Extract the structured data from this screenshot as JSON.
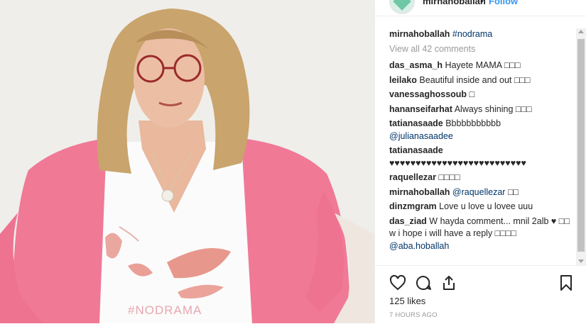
{
  "post": {
    "username": "mirnahoballah",
    "separator": "•",
    "follow_label": "Follow",
    "photo_shirt_text": "#NODRAMA"
  },
  "caption": {
    "username": "mirnahoballah",
    "text": "#nodrama"
  },
  "view_all": "View all 42 comments",
  "comments": [
    {
      "user": "das_asma_h",
      "text": "Hayete MAMA □□□"
    },
    {
      "user": "leilako",
      "text": "Beautiful inside and out □□□"
    },
    {
      "user": "vanessaghossoub",
      "text": "□"
    },
    {
      "user": "hananseifarhat",
      "text": "Always shining □□□"
    },
    {
      "user": "tatianasaade",
      "text": "Bbbbbbbbbbb",
      "mention": "@julianasaadee"
    },
    {
      "user": "tatianasaade",
      "text": "♥♥♥♥♥♥♥♥♥♥♥♥♥♥♥♥♥♥♥♥♥♥♥♥♥♥"
    },
    {
      "user": "raquellezar",
      "text": "□□□□"
    },
    {
      "user": "mirnahoballah",
      "mention": "@raquellezar",
      "text": "□□"
    },
    {
      "user": "dinzmgram",
      "text": "Love u love u lovee uuu"
    },
    {
      "user": "das_ziad",
      "text": "W hayda comment... mnil 2alb ♥ □□ w i hope i will have a reply □□□□",
      "mention": "@aba.hoballah"
    }
  ],
  "actions": {
    "like_icon": "heart-icon",
    "comment_icon": "comment-icon",
    "share_icon": "share-icon",
    "save_icon": "bookmark-icon"
  },
  "likes": "125 likes",
  "time_ago": "7 HOURS AGO",
  "colors": {
    "link": "#003569",
    "follow": "#3897f0",
    "muted": "#999999",
    "cardigan": "#f27a9b"
  }
}
